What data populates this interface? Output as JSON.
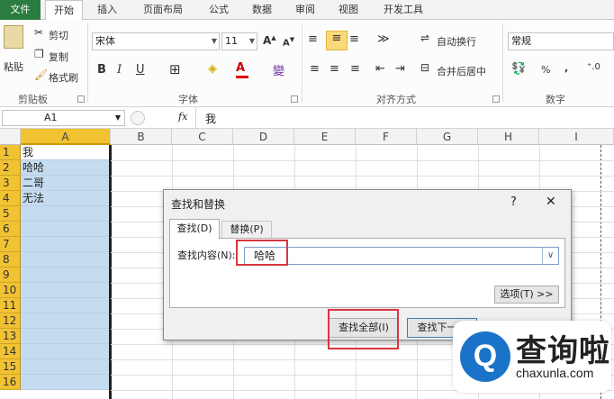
{
  "tabs": [
    "文件",
    "开始",
    "插入",
    "页面布局",
    "公式",
    "数据",
    "审阅",
    "视图",
    "开发工具"
  ],
  "clipboard": {
    "paste": "粘贴",
    "cut": "剪切",
    "copy": "复制",
    "format_painter": "格式刷",
    "label": "剪贴板"
  },
  "font": {
    "name": "宋体",
    "size": "11",
    "bold": "B",
    "italic": "I",
    "underline": "U",
    "label": "字体"
  },
  "alignment": {
    "wrap": "自动换行",
    "merge": "合并后居中",
    "label": "对齐方式"
  },
  "number": {
    "format": "常规",
    "percent": "%",
    "comma": ",",
    "label": "数字"
  },
  "formula_bar": {
    "cell_ref": "A1",
    "fx": "fx",
    "content": "我"
  },
  "columns": [
    "A",
    "B",
    "C",
    "D",
    "E",
    "F",
    "G",
    "H",
    "I"
  ],
  "rows": [
    "1",
    "2",
    "3",
    "4",
    "5",
    "6",
    "7",
    "8",
    "9",
    "10",
    "11",
    "12",
    "13",
    "14",
    "15",
    "16"
  ],
  "cells_a": [
    "我",
    "哈哈",
    "二哥",
    "无法"
  ],
  "dialog": {
    "title": "查找和替换",
    "help": "?",
    "close": "✕",
    "tab_find": "查找(D)",
    "tab_replace": "替换(P)",
    "find_label": "查找内容(N):",
    "find_value": "哈哈",
    "options": "选项(T) >>",
    "find_all": "查找全部(I)",
    "find_next": "查找下一个"
  },
  "watermark": {
    "brand": "查询啦",
    "url": "chaxunla.com"
  }
}
